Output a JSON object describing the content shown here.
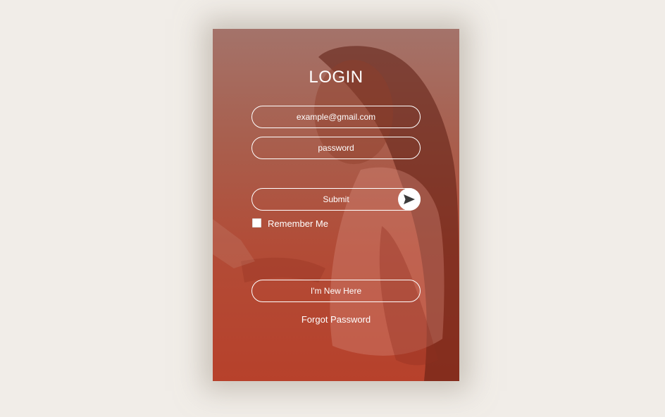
{
  "login": {
    "title": "LOGIN",
    "email_field": {
      "placeholder": "example@gmail.com"
    },
    "password_field": {
      "placeholder": "password"
    },
    "submit_label": "Submit",
    "submit_icon": "send-icon",
    "remember_me": {
      "label": "Remember Me",
      "checked": false
    },
    "new_here_label": "I'm New Here",
    "forgot_password_label": "Forgot Password"
  },
  "colors": {
    "page_background": "#f1ede8",
    "overlay_top": "#a4736a",
    "overlay_bottom": "#b7412b",
    "foreground": "#ffffff"
  }
}
